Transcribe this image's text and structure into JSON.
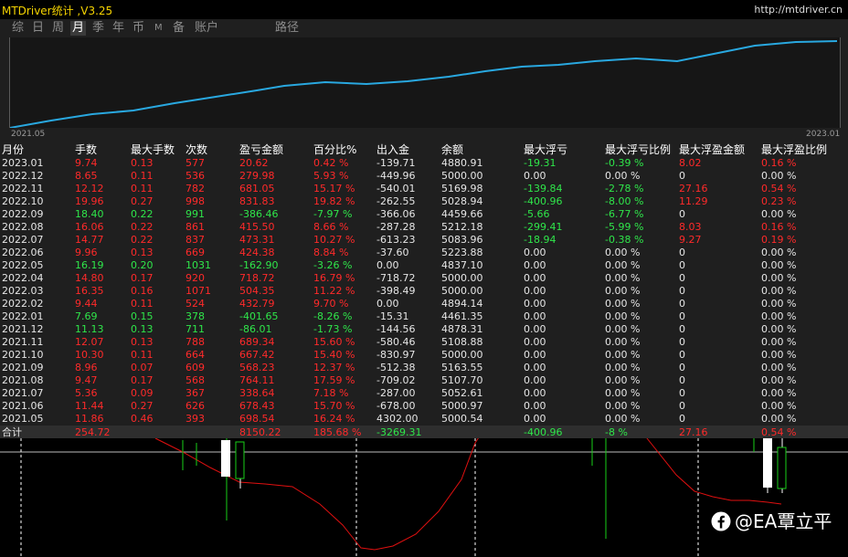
{
  "header": {
    "title": "MTDriver统计 ,V3.25",
    "url": "http://mtdriver.cn"
  },
  "tabs": [
    "综",
    "日",
    "周",
    "月",
    "季",
    "年",
    "币",
    "M",
    "备",
    "账户",
    "路径"
  ],
  "active_tab": "月",
  "equity_chart": {
    "x_start_label": "2021.05",
    "x_end_label": "2023.01",
    "line_color": "#29a8e0"
  },
  "table": {
    "columns": [
      "月份",
      "手数",
      "最大手数",
      "次数",
      "盈亏金额",
      "百分比%",
      "出入金",
      "余额",
      "最大浮亏",
      "最大浮亏比例",
      "最大浮盈金额",
      "最大浮盈比例"
    ],
    "rows": [
      [
        "2023.01",
        "9.74",
        "0.13",
        "577",
        "20.62",
        "0.42 %",
        "-139.71",
        "4880.91",
        "-19.31",
        "-0.39 %",
        "8.02",
        "0.16 %"
      ],
      [
        "2022.12",
        "8.65",
        "0.11",
        "536",
        "279.98",
        "5.93 %",
        "-449.96",
        "5000.00",
        "0.00",
        "0.00 %",
        "0",
        "0.00 %"
      ],
      [
        "2022.11",
        "12.12",
        "0.11",
        "782",
        "681.05",
        "15.17 %",
        "-540.01",
        "5169.98",
        "-139.84",
        "-2.78 %",
        "27.16",
        "0.54 %"
      ],
      [
        "2022.10",
        "19.96",
        "0.27",
        "998",
        "831.83",
        "19.82 %",
        "-262.55",
        "5028.94",
        "-400.96",
        "-8.00 %",
        "11.29",
        "0.23 %"
      ],
      [
        "2022.09",
        "18.40",
        "0.22",
        "991",
        "-386.46",
        "-7.97 %",
        "-366.06",
        "4459.66",
        "-5.66",
        "-6.77 %",
        "0",
        "0.00 %"
      ],
      [
        "2022.08",
        "16.06",
        "0.22",
        "861",
        "415.50",
        "8.66 %",
        "-287.28",
        "5212.18",
        "-299.41",
        "-5.99 %",
        "8.03",
        "0.16 %"
      ],
      [
        "2022.07",
        "14.77",
        "0.22",
        "837",
        "473.31",
        "10.27 %",
        "-613.23",
        "5083.96",
        "-18.94",
        "-0.38 %",
        "9.27",
        "0.19 %"
      ],
      [
        "2022.06",
        "9.96",
        "0.13",
        "669",
        "424.38",
        "8.84 %",
        "-37.60",
        "5223.88",
        "0.00",
        "0.00 %",
        "0",
        "0.00 %"
      ],
      [
        "2022.05",
        "16.19",
        "0.20",
        "1031",
        "-162.90",
        "-3.26 %",
        "0.00",
        "4837.10",
        "0.00",
        "0.00 %",
        "0",
        "0.00 %"
      ],
      [
        "2022.04",
        "14.80",
        "0.17",
        "920",
        "718.72",
        "16.79 %",
        "-718.72",
        "5000.00",
        "0.00",
        "0.00 %",
        "0",
        "0.00 %"
      ],
      [
        "2022.03",
        "16.35",
        "0.16",
        "1071",
        "504.35",
        "11.22 %",
        "-398.49",
        "5000.00",
        "0.00",
        "0.00 %",
        "0",
        "0.00 %"
      ],
      [
        "2022.02",
        "9.44",
        "0.11",
        "524",
        "432.79",
        "9.70 %",
        "0.00",
        "4894.14",
        "0.00",
        "0.00 %",
        "0",
        "0.00 %"
      ],
      [
        "2022.01",
        "7.69",
        "0.15",
        "378",
        "-401.65",
        "-8.26 %",
        "-15.31",
        "4461.35",
        "0.00",
        "0.00 %",
        "0",
        "0.00 %"
      ],
      [
        "2021.12",
        "11.13",
        "0.13",
        "711",
        "-86.01",
        "-1.73 %",
        "-144.56",
        "4878.31",
        "0.00",
        "0.00 %",
        "0",
        "0.00 %"
      ],
      [
        "2021.11",
        "12.07",
        "0.13",
        "788",
        "689.34",
        "15.60 %",
        "-580.46",
        "5108.88",
        "0.00",
        "0.00 %",
        "0",
        "0.00 %"
      ],
      [
        "2021.10",
        "10.30",
        "0.11",
        "664",
        "667.42",
        "15.40 %",
        "-830.97",
        "5000.00",
        "0.00",
        "0.00 %",
        "0",
        "0.00 %"
      ],
      [
        "2021.09",
        "8.96",
        "0.07",
        "609",
        "568.23",
        "12.37 %",
        "-512.38",
        "5163.55",
        "0.00",
        "0.00 %",
        "0",
        "0.00 %"
      ],
      [
        "2021.08",
        "9.47",
        "0.17",
        "568",
        "764.11",
        "17.59 %",
        "-709.02",
        "5107.70",
        "0.00",
        "0.00 %",
        "0",
        "0.00 %"
      ],
      [
        "2021.07",
        "5.36",
        "0.09",
        "367",
        "338.64",
        "7.18 %",
        "-287.00",
        "5052.61",
        "0.00",
        "0.00 %",
        "0",
        "0.00 %"
      ],
      [
        "2021.06",
        "11.44",
        "0.27",
        "626",
        "678.43",
        "15.70 %",
        "-678.00",
        "5000.97",
        "0.00",
        "0.00 %",
        "0",
        "0.00 %"
      ],
      [
        "2021.05",
        "11.86",
        "0.46",
        "393",
        "698.54",
        "16.24 %",
        "4302.00",
        "5000.54",
        "0.00",
        "0.00 %",
        "0",
        "0.00 %"
      ]
    ],
    "total": [
      "合计",
      "254.72",
      "",
      "",
      "8150.22",
      "185.68 %",
      "-3269.31",
      "",
      "-400.96",
      "-8 %",
      "27.16",
      "0.54 %"
    ]
  },
  "watermark": "@EA覃立平",
  "colors": {
    "positive": "#ff2a2a",
    "negative": "#2fe64a",
    "neutral": "#e6e6e6",
    "title": "#f5d300",
    "equity_line": "#29a8e0"
  }
}
